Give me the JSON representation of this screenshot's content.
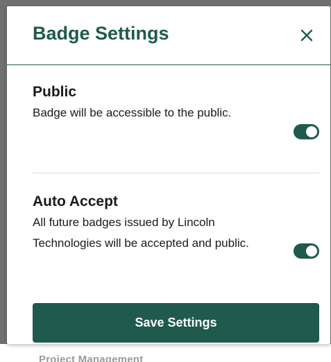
{
  "modal": {
    "title": "Badge Settings",
    "close_icon": "close-icon",
    "save_label": "Save Settings"
  },
  "settings": [
    {
      "title": "Public",
      "description": "Badge will be accessible to the public.",
      "enabled": true
    },
    {
      "title": "Auto Accept",
      "description": "All future badges issued by Lincoln Technologies will be accepted and public.",
      "enabled": true
    }
  ],
  "background": {
    "peek_text": "Project Management"
  },
  "colors": {
    "accent": "#1f5a4c",
    "backdrop": "#707070",
    "divider": "#dcdcdc",
    "text": "#1a1a1a"
  }
}
